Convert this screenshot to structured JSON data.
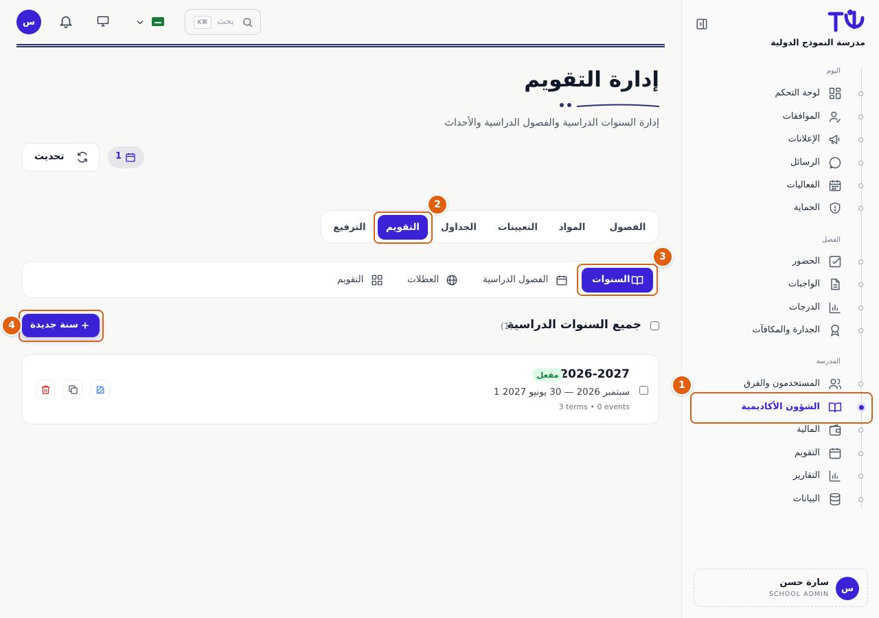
{
  "sidebar": {
    "school_name": "مدرسة النموذج الدولية",
    "sections": [
      {
        "label": "اليوم",
        "items": [
          {
            "label": "لوحة التحكم",
            "icon": "dashboard-grid-icon"
          },
          {
            "label": "الموافقات",
            "icon": "user-check-icon"
          },
          {
            "label": "الإعلانات",
            "icon": "megaphone-icon"
          },
          {
            "label": "الرسائل",
            "icon": "chat-bubble-icon"
          },
          {
            "label": "الفعاليات",
            "icon": "calendar-grid-icon"
          },
          {
            "label": "الحماية",
            "icon": "shield-alert-icon"
          }
        ]
      },
      {
        "label": "الفصل",
        "items": [
          {
            "label": "الحضور",
            "icon": "checkbox-icon"
          },
          {
            "label": "الواجبات",
            "icon": "document-icon"
          },
          {
            "label": "الدرجات",
            "icon": "bar-chart-icon"
          },
          {
            "label": "الجدارة والمكافآت",
            "icon": "award-icon"
          }
        ]
      },
      {
        "label": "المدرسة",
        "items": [
          {
            "label": "المستخدمون والفرق",
            "icon": "users-icon"
          },
          {
            "label": "الشؤون الأكاديمية",
            "icon": "open-book-icon",
            "active": true
          },
          {
            "label": "المالية",
            "icon": "wallet-icon"
          },
          {
            "label": "التقويم",
            "icon": "calendar-icon"
          },
          {
            "label": "التقارير",
            "icon": "bar-chart-icon"
          },
          {
            "label": "البيانات",
            "icon": "database-icon"
          }
        ]
      }
    ],
    "user": {
      "initial": "س",
      "name": "سارة حسن",
      "role": "SCHOOL ADMIN"
    }
  },
  "topbar": {
    "avatar_initial": "س",
    "search_placeholder": "بحث",
    "shortcut": "K⌘"
  },
  "header": {
    "title": "إدارة التقويم",
    "subtitle": "إدارة السنوات الدراسية والفصول الدراسية والأحداث",
    "refresh_label": "تحديث",
    "calendar_count": "1"
  },
  "main_tabs": [
    "الفصول",
    "المواد",
    "التعيينات",
    "الجداول",
    "التقويم",
    "الترفيع"
  ],
  "main_tab_active": "التقويم",
  "sub_tabs": [
    {
      "label": "السنوات",
      "icon": "open-book-icon",
      "active": true
    },
    {
      "label": "الفصول الدراسية",
      "icon": "calendar-icon"
    },
    {
      "label": "العطلات",
      "icon": "globe-icon"
    },
    {
      "label": "التقويم",
      "icon": "grid-icon"
    }
  ],
  "section": {
    "title": "جميع السنوات الدراسية",
    "count": "(1)",
    "new_button": "سنة جديدة"
  },
  "years": [
    {
      "name": "2026-2027",
      "status": "مفعل",
      "dates": "1 سبتمبر 2026 — 30 يونيو 2027",
      "meta": "3 terms • 0 events"
    }
  ],
  "annotations": [
    "1",
    "2",
    "3",
    "4"
  ],
  "colors": {
    "accent": "#3b22d6",
    "highlight": "#d9621a",
    "active_badge_bg": "#dcfce7",
    "active_badge_text": "#15803d",
    "delete": "#dc2626",
    "edit": "#3b82f6"
  }
}
